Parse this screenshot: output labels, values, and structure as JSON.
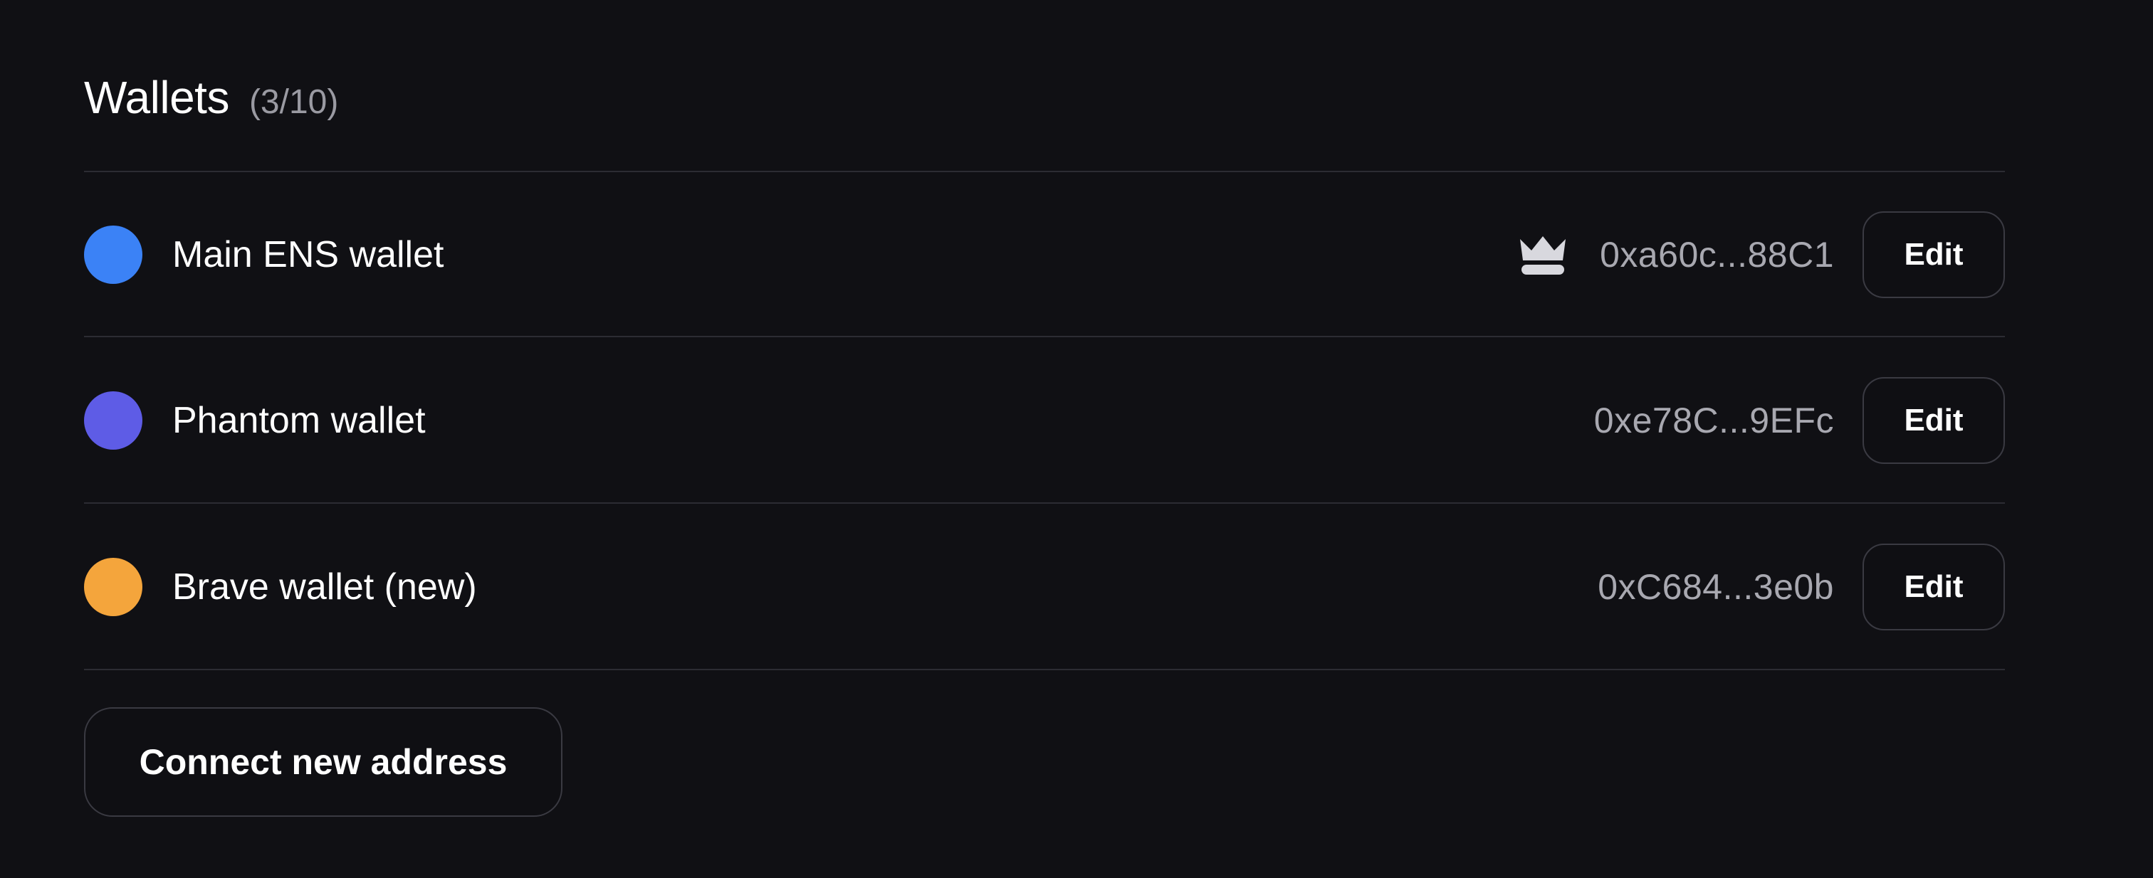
{
  "header": {
    "title": "Wallets",
    "count": "(3/10)"
  },
  "wallets": [
    {
      "name": "Main ENS wallet",
      "address": "0xa60c...88C1",
      "color": "#3b82f6",
      "primary": true,
      "badge_icon": "crown-icon",
      "edit_label": "Edit"
    },
    {
      "name": "Phantom wallet",
      "address": "0xe78C...9EFc",
      "color": "#5e5ce6",
      "primary": false,
      "edit_label": "Edit"
    },
    {
      "name": "Brave wallet (new)",
      "address": "0xC684...3e0b",
      "color": "#f4a53c",
      "primary": false,
      "edit_label": "Edit"
    }
  ],
  "connect_button": {
    "label": "Connect new address"
  },
  "theme": {
    "background": "#101014",
    "divider": "#2c2c33",
    "muted_text": "#a8a8b0"
  }
}
